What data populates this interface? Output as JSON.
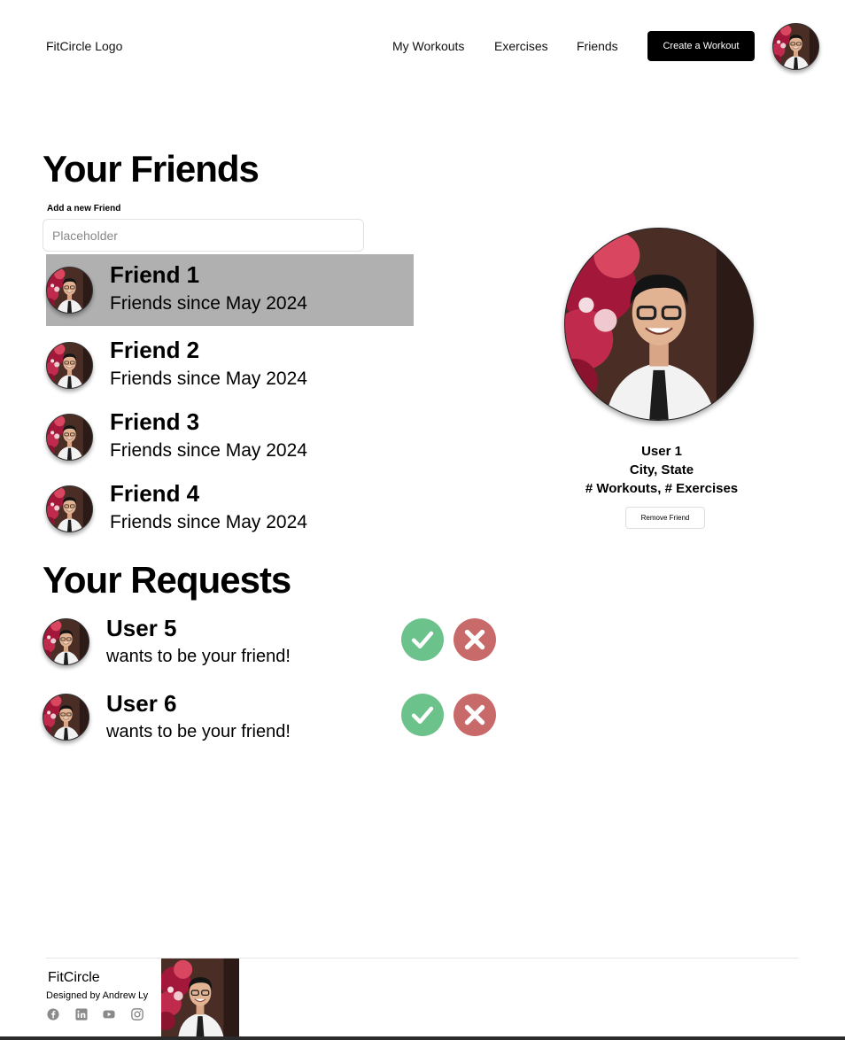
{
  "header": {
    "logo": "FitCircle Logo",
    "nav": [
      "My Workouts",
      "Exercises",
      "Friends"
    ],
    "cta": "Create a Workout"
  },
  "friends_section": {
    "title": "Your Friends",
    "add_label": "Add a new Friend",
    "search_placeholder": "Placeholder",
    "friends": [
      {
        "name": "Friend 1",
        "since": "Friends since May 2024",
        "selected": true
      },
      {
        "name": "Friend 2",
        "since": "Friends since May 2024",
        "selected": false
      },
      {
        "name": "Friend 3",
        "since": "Friends since May 2024",
        "selected": false
      },
      {
        "name": "Friend 4",
        "since": "Friends since May 2024",
        "selected": false
      }
    ]
  },
  "requests_section": {
    "title": "Your Requests",
    "requests": [
      {
        "name": "User 5",
        "message": "wants to be your friend!"
      },
      {
        "name": "User 6",
        "message": "wants to be your friend!"
      }
    ]
  },
  "profile": {
    "name": "User 1",
    "location": "City, State",
    "stats": "# Workouts, # Exercises",
    "remove_label": "Remove Friend"
  },
  "footer": {
    "title": "FitCircle",
    "credit": "Designed by Andrew Ly",
    "social_icons": [
      "facebook-icon",
      "linkedin-icon",
      "youtube-icon",
      "instagram-icon"
    ]
  },
  "colors": {
    "accept": "#6cc28b",
    "decline": "#c96a6a",
    "selected_row": "#b1b0b1",
    "cta_bg": "#000000"
  }
}
